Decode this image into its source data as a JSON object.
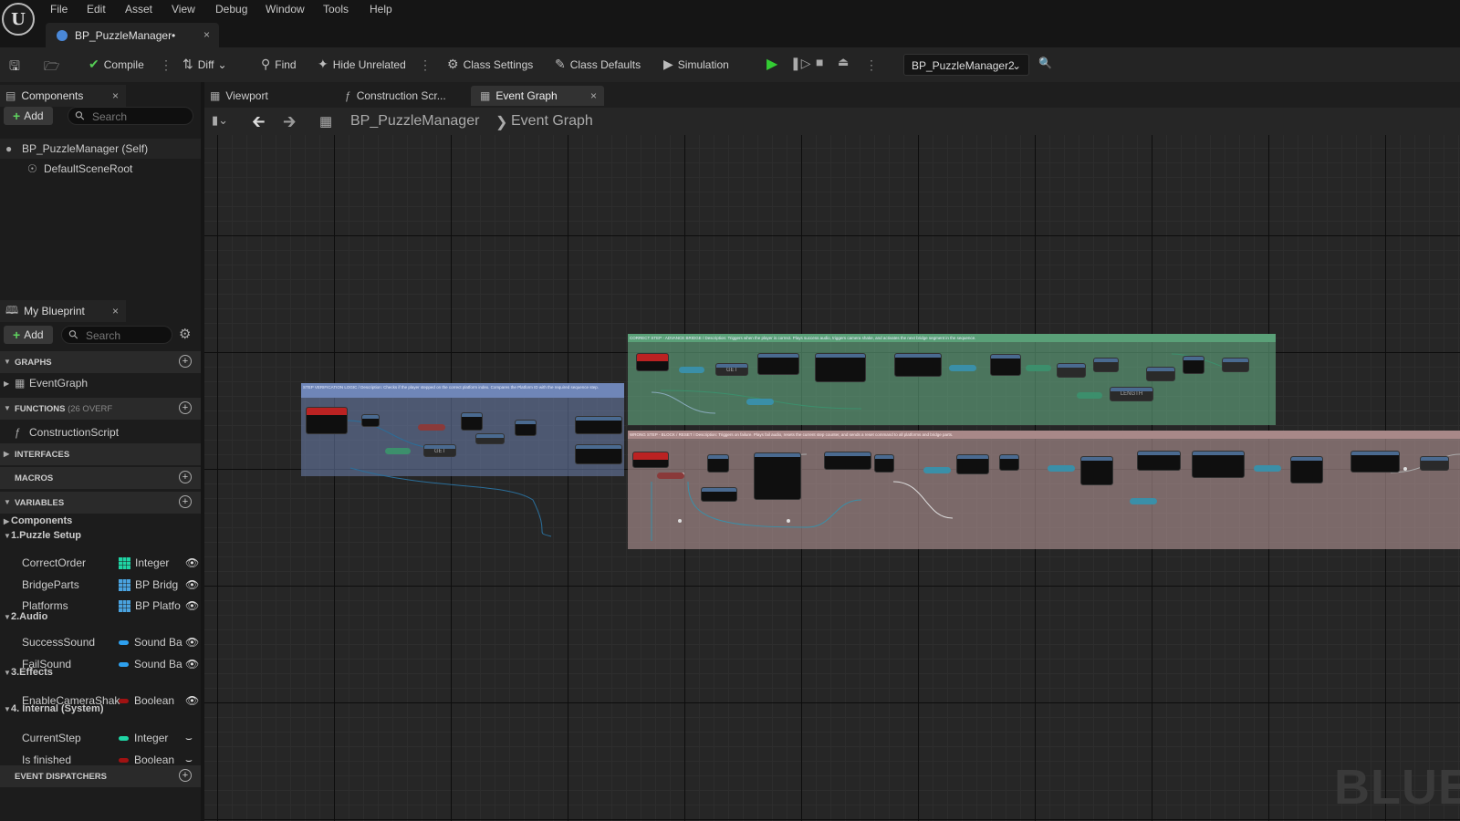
{
  "app": {
    "logo": "U"
  },
  "menu": [
    "File",
    "Edit",
    "Asset",
    "View",
    "Debug",
    "Window",
    "Tools",
    "Help"
  ],
  "document_tab": {
    "title": "BP_PuzzleManager•",
    "close": "×"
  },
  "toolbar": {
    "compile": "Compile",
    "diff": "Diff",
    "find": "Find",
    "hide_unrelated": "Hide Unrelated",
    "class_settings": "Class Settings",
    "class_defaults": "Class Defaults",
    "simulation": "Simulation",
    "debug_object": "BP_PuzzleManager2"
  },
  "components_panel": {
    "tab": "Components",
    "add": "Add",
    "search_placeholder": "Search",
    "items": [
      "BP_PuzzleManager (Self)",
      "DefaultSceneRoot"
    ]
  },
  "my_blueprint": {
    "tab": "My Blueprint",
    "add": "Add",
    "search_placeholder": "Search",
    "sections": {
      "graphs": "GRAPHS",
      "functions": "FUNCTIONS",
      "functions_note": "(26 OVERF",
      "interfaces": "INTERFACES",
      "macros": "MACROS",
      "variables": "VARIABLES",
      "event_dispatchers": "EVENT DISPATCHERS"
    },
    "graphs": [
      "EventGraph"
    ],
    "functions": [
      "ConstructionScript"
    ],
    "categories": {
      "components": "Components",
      "puzzle_setup": "1.Puzzle Setup",
      "audio": "2.Audio",
      "effects": "3.Effects",
      "internal": "4. Internal (System)"
    },
    "variables": [
      {
        "name": "CorrectOrder",
        "type": "Integer",
        "color": "#1fd4a4",
        "kind": "array",
        "vis": "eye"
      },
      {
        "name": "BridgeParts",
        "type": "BP Bridg",
        "color": "#4aa3e0",
        "kind": "array",
        "vis": "eye"
      },
      {
        "name": "Platforms",
        "type": "BP Platfo",
        "color": "#4aa3e0",
        "kind": "array",
        "vis": "eye"
      },
      {
        "name": "SuccessSound",
        "type": "Sound Ba",
        "color": "#2ea0ee",
        "kind": "single",
        "vis": "eye"
      },
      {
        "name": "FailSound",
        "type": "Sound Ba",
        "color": "#2ea0ee",
        "kind": "single",
        "vis": "eye"
      },
      {
        "name": "EnableCameraShak",
        "type": "Boolean",
        "color": "#a01212",
        "kind": "single",
        "vis": "eye"
      },
      {
        "name": "CurrentStep",
        "type": "Integer",
        "color": "#1fd4a4",
        "kind": "single",
        "vis": "closed"
      },
      {
        "name": "Is finished",
        "type": "Boolean",
        "color": "#a01212",
        "kind": "single",
        "vis": "closed"
      }
    ]
  },
  "graph_tabs": {
    "viewport": "Viewport",
    "construction": "Construction Scr...",
    "event_graph": "Event Graph"
  },
  "breadcrumb": {
    "blueprint": "BP_PuzzleManager",
    "graph": "Event Graph"
  },
  "comments": {
    "verification": "STEP VERIFICATION LOGIC / Description: Checks if the player stepped on the correct platform index. Compares the Platform ID with the required sequence step.",
    "correct": "CORRECT STEP - ADVANCE BRIDGE / Description: Triggers when the player is correct. Plays success audio, triggers camera shake, and activates the next bridge segment in the sequence.",
    "wrong": "WRONG STEP - BLOCK / RESET / Description: Triggers on failure. Plays fail audio, resets the current step counter, and sends a reset command to all platforms and bridge parts."
  },
  "node_labels": {
    "get1": "GET",
    "get2": "GET",
    "length": "LENGTH"
  },
  "watermark": "BLUEP"
}
